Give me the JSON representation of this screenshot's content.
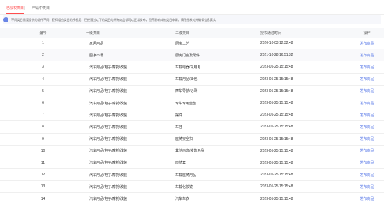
{
  "tabs": {
    "active": "已授权类目",
    "separator": "|",
    "pending": "申请中类目"
  },
  "notice": {
    "icon_text": "i",
    "text": "不同类目需要提供的证件不同，获得相应类目的授权后，已经通过以下的类目的所有商品都可以正常发布，但不影响其他类目申请，请仔细核对并确保信息真实"
  },
  "table": {
    "headers": {
      "index": "编号",
      "level1": "一级类目",
      "level2": "二级类目",
      "time": "授权通过时间",
      "operation": "操作"
    },
    "rows": [
      {
        "index": "1",
        "level1": "家居用品",
        "level2": "厨房工艺",
        "time": "2020-10-03 12:32:48",
        "action": "发布商品"
      },
      {
        "index": "2",
        "level1": "图家市场",
        "level2": "厨房门窗及配件",
        "time": "2021-10-28 16:51:32",
        "action": "发布商品"
      },
      {
        "index": "3",
        "level1": "汽车用品/电子/摩托/改装",
        "level2": "车载电器/车用电",
        "time": "2023-05-25 15:15:48",
        "action": "发布商品"
      },
      {
        "index": "4",
        "level1": "汽车用品/电子/摩托/改装",
        "level2": "车载用品/其他",
        "time": "2023-05-25 15:15:48",
        "action": "发布商品"
      },
      {
        "index": "5",
        "level1": "汽车用品/电子/摩托/改装",
        "level2": "摩车导航/记录",
        "time": "2023-05-25 15:15:48",
        "action": "发布商品"
      },
      {
        "index": "6",
        "level1": "汽车用品/电子/摩托/改装",
        "level2": "专车专用坐垫",
        "time": "2023-05-25 15:15:48",
        "action": "发布商品"
      },
      {
        "index": "7",
        "level1": "汽车用品/电子/摩托/改装",
        "level2": "摆件",
        "time": "2023-05-25 15:15:48",
        "action": "发布商品"
      },
      {
        "index": "8",
        "level1": "汽车用品/电子/摩托/改装",
        "level2": "车挂",
        "time": "2023-05-25 15:15:48",
        "action": "发布商品"
      },
      {
        "index": "9",
        "level1": "汽车用品/电子/摩托/改装",
        "level2": "座椅安全扣",
        "time": "2023-05-25 15:15:48",
        "action": "发布商品"
      },
      {
        "index": "10",
        "level1": "汽车用品/电子/摩托/改装",
        "level2": "其他内饰/装饰用品",
        "time": "2023-05-25 15:15:48",
        "action": "发布商品"
      },
      {
        "index": "11",
        "level1": "汽车用品/电子/摩托/改装",
        "level2": "座椅套",
        "time": "2023-05-25 15:15:48",
        "action": "发布商品"
      },
      {
        "index": "12",
        "level1": "汽车用品/电子/摩托/改装",
        "level2": "车载座椅用品",
        "time": "2023-05-25 15:15:48",
        "action": "发布商品"
      },
      {
        "index": "13",
        "level1": "汽车用品/电子/摩托/改装",
        "level2": "车载化妆镜",
        "time": "2023-05-25 15:15:48",
        "action": "发布商品"
      },
      {
        "index": "14",
        "level1": "汽车用品/电子/摩托/改装",
        "level2": "汽车车衣",
        "time": "2023-05-25 15:15:48",
        "action": "发布商品"
      }
    ]
  },
  "colors": {
    "accent": "#ff4d4f",
    "link": "#5b7be8",
    "info": "#6a86e6",
    "header_bg": "#f7f8fa"
  }
}
